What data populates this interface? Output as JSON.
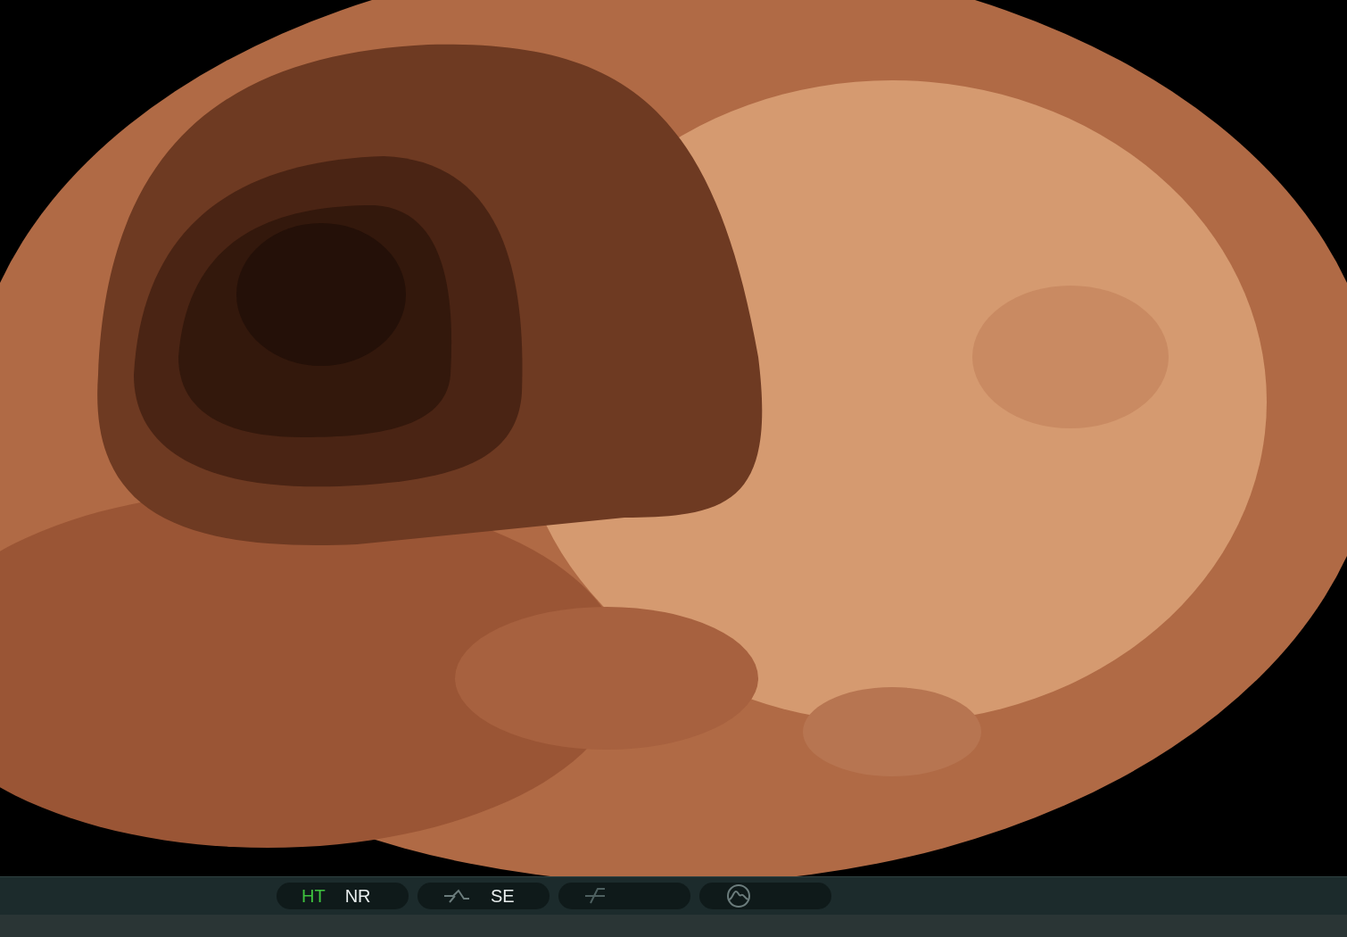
{
  "status_bar": {
    "groups": [
      {
        "items": [
          {
            "kind": "label",
            "text": "HT",
            "highlighted": true
          },
          {
            "kind": "label",
            "text": "NR",
            "highlighted": false
          }
        ]
      },
      {
        "items": [
          {
            "kind": "curve-icon"
          },
          {
            "kind": "label",
            "text": "SE",
            "highlighted": false
          }
        ]
      },
      {
        "items": [
          {
            "kind": "slash-icon"
          }
        ]
      },
      {
        "items": [
          {
            "kind": "wave-icon"
          }
        ]
      }
    ]
  }
}
